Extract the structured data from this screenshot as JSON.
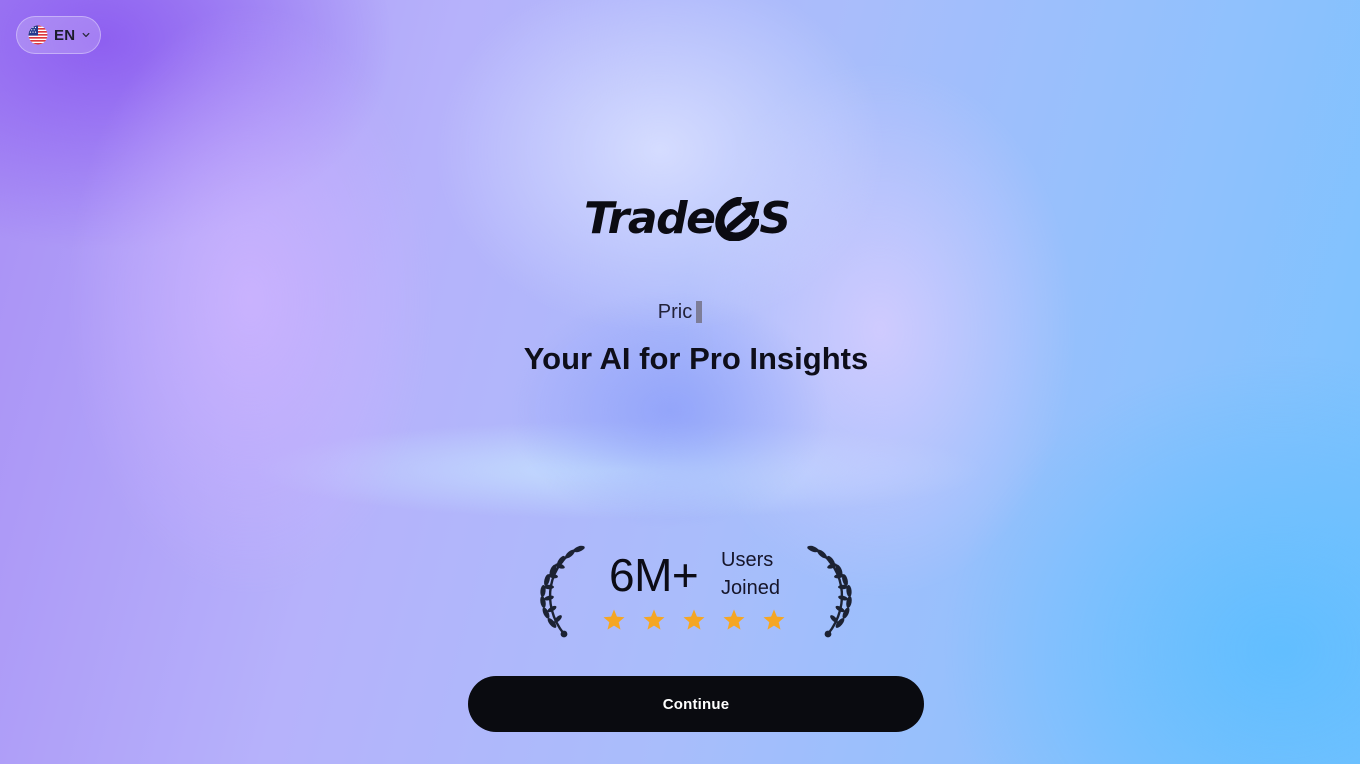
{
  "language_switcher": {
    "code": "EN",
    "flag_icon": "us-flag-icon",
    "dropdown_icon": "chevron-down-icon"
  },
  "brand": {
    "logo_text": "Trade",
    "logo_suffix_icon": "os-arrow-icon",
    "logo_tail": "S"
  },
  "hero": {
    "typing_text": "Pric",
    "tagline": "Your AI for Pro Insights"
  },
  "social_proof": {
    "count": "6M+",
    "label_line1": "Users",
    "label_line2": "Joined",
    "rating_stars": 5,
    "star_color": "#f5a623",
    "laurel_color": "#1c2233"
  },
  "cta": {
    "continue_label": "Continue"
  }
}
